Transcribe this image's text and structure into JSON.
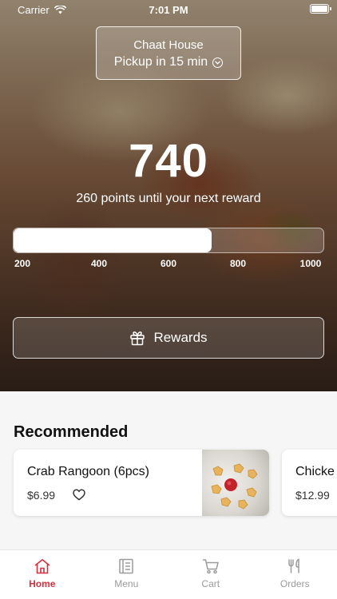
{
  "status_bar": {
    "carrier": "Carrier",
    "time": "7:01 PM"
  },
  "header": {
    "restaurant_name": "Chaat House",
    "pickup_text": "Pickup in 15 min"
  },
  "rewards": {
    "points": "740",
    "caption": "260 points until your next reward",
    "progress_fraction": 0.64,
    "ticks": [
      "200",
      "400",
      "600",
      "800",
      "1000"
    ],
    "button_label": "Rewards"
  },
  "recommended": {
    "title": "Recommended",
    "items": [
      {
        "name": "Crab Rangoon (6pcs)",
        "price": "$6.99"
      },
      {
        "name": "Chicke",
        "price": "$12.99"
      }
    ]
  },
  "tabs": [
    {
      "label": "Home",
      "icon": "home-icon",
      "active": true
    },
    {
      "label": "Menu",
      "icon": "menu-icon",
      "active": false
    },
    {
      "label": "Cart",
      "icon": "cart-icon",
      "active": false
    },
    {
      "label": "Orders",
      "icon": "utensils-icon",
      "active": false
    }
  ],
  "colors": {
    "accent": "#d33040",
    "inactive_tab": "#9b9b9b"
  }
}
